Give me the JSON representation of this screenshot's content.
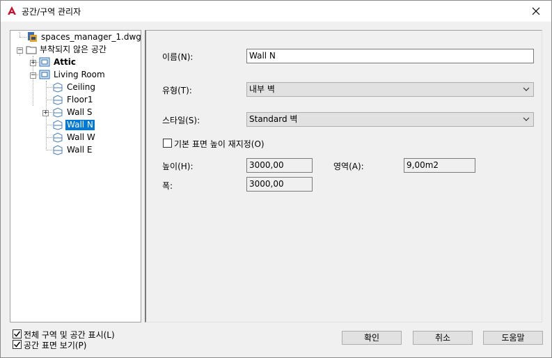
{
  "window": {
    "title": "공간/구역 관리자",
    "app_icon": "autocad-a-icon",
    "close_icon": "close-icon"
  },
  "tree": {
    "root": {
      "label": "spaces_manager_1.dwg",
      "icon": "drawing-file-icon"
    },
    "unattached": {
      "label": "부착되지 않은 공간",
      "icon": "folder-icon"
    },
    "attic": {
      "label": "Attic",
      "icon": "zone-icon"
    },
    "living_room": {
      "label": "Living Room",
      "icon": "zone-icon"
    },
    "surfaces": [
      {
        "label": "Ceiling",
        "icon": "surface-icon"
      },
      {
        "label": "Floor1",
        "icon": "surface-icon"
      },
      {
        "label": "Wall S",
        "icon": "surface-icon"
      },
      {
        "label": "Wall N",
        "icon": "surface-icon",
        "selected": true
      },
      {
        "label": "Wall W",
        "icon": "surface-icon"
      },
      {
        "label": "Wall E",
        "icon": "surface-icon"
      }
    ]
  },
  "properties": {
    "name_label": "이름(N):",
    "name_value": "Wall N",
    "type_label": "유형(T):",
    "type_value": "내부 벽",
    "style_label": "스타일(S):",
    "style_value": "Standard 벽",
    "override_label": "기본 표면 높이 재지정(O)",
    "override_checked": false,
    "height_label": "높이(H):",
    "height_value": "3000,00",
    "area_label": "영역(A):",
    "area_value": "9,00m2",
    "width_label": "폭:",
    "width_value": "3000,00"
  },
  "footer": {
    "show_all_label": "전체 구역 및 공간 표시(L)",
    "show_all_checked": true,
    "show_surfaces_label": "공간 표면 보기(P)",
    "show_surfaces_checked": true,
    "ok_label": "확인",
    "cancel_label": "취소",
    "help_label": "도움말"
  },
  "colors": {
    "selection": "#0078d7",
    "autocad_red": "#c8102e"
  }
}
